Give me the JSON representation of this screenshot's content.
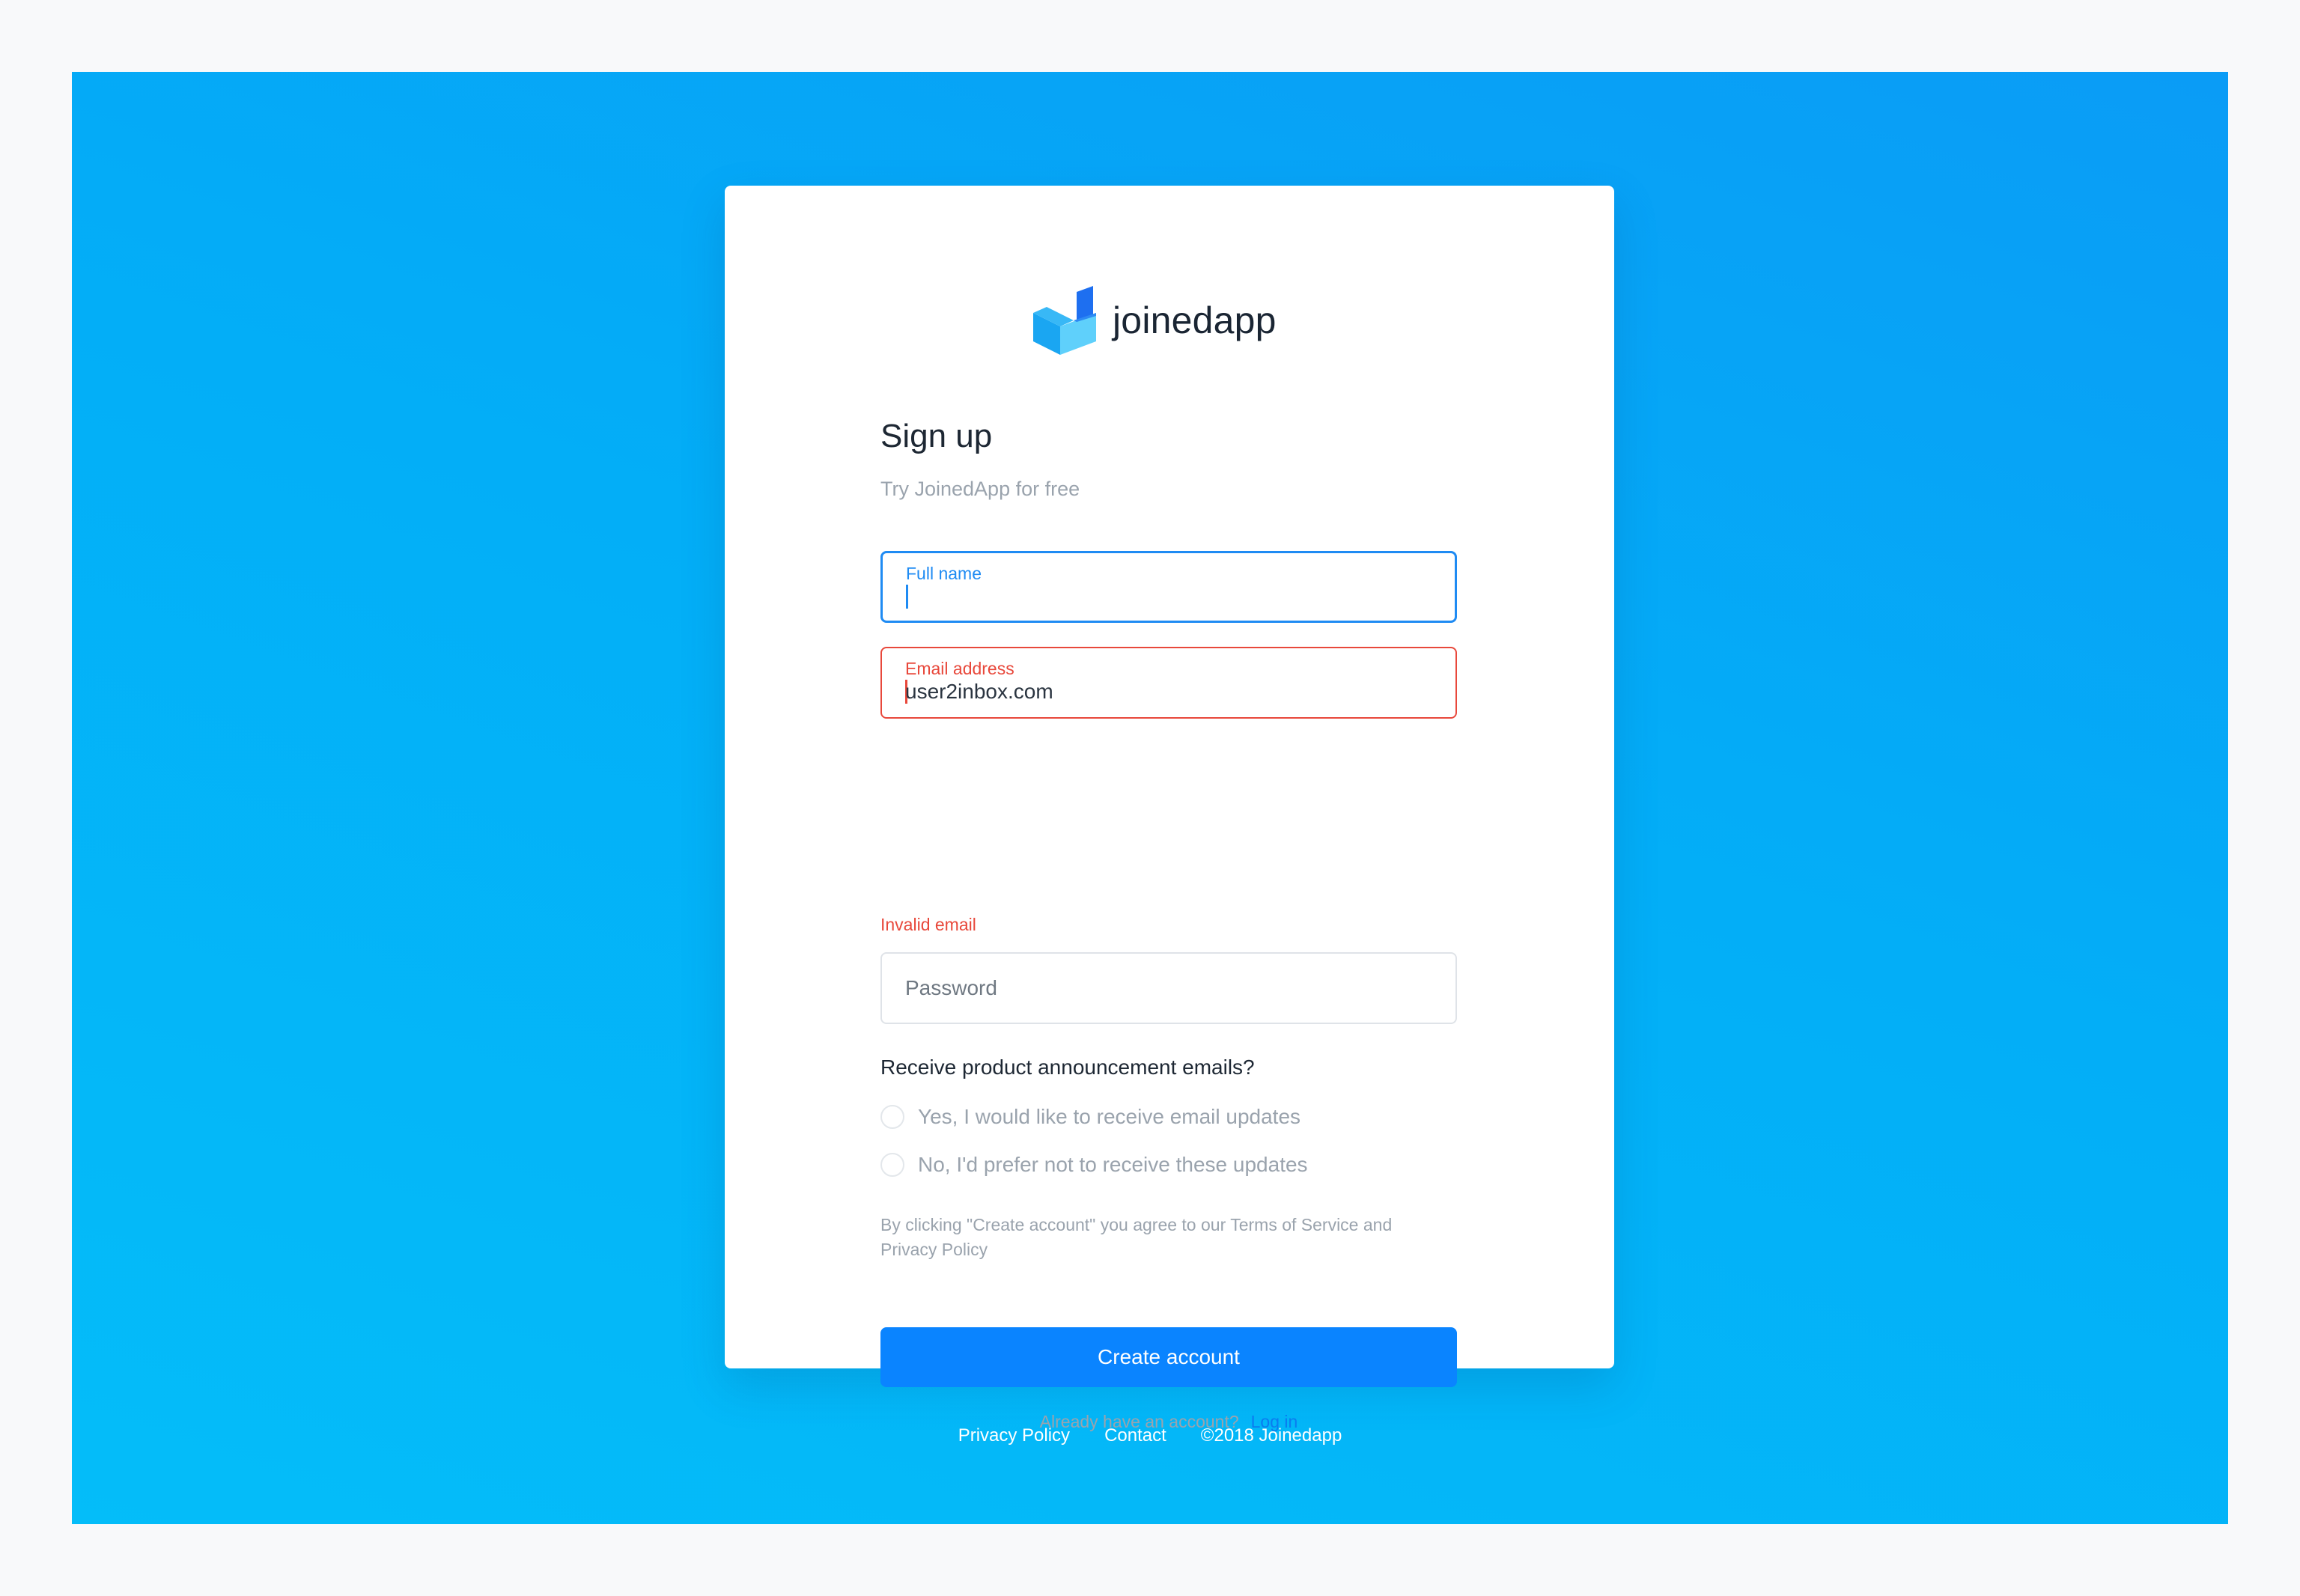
{
  "brand": {
    "name": "joinedapp",
    "logo_icon": "joinedapp-box-logo",
    "colors": {
      "primary": "#0a84ff",
      "error": "#e8483b",
      "background": "#03aef7"
    }
  },
  "signup": {
    "title": "Sign up",
    "subtitle": "Try JoinedApp for free",
    "full_name": {
      "label": "Full name",
      "value": ""
    },
    "email": {
      "label": "Email address",
      "value": "user2inbox.com",
      "error": "Invalid email"
    },
    "password": {
      "placeholder": "Password"
    },
    "emails_question": "Receive product announcement emails?",
    "options": [
      {
        "label": "Yes, I would like to receive email updates"
      },
      {
        "label": "No, I'd prefer not to receive these updates"
      }
    ],
    "legal_line1": "By clicking \"Create account\" you agree to our Terms of Service  and",
    "legal_line2": "Privacy Policy",
    "submit_label": "Create account",
    "already_text": "Already have an account?",
    "login_label": "Log in"
  },
  "footer": {
    "privacy": "Privacy Policy",
    "contact": "Contact",
    "copyright": "©2018 Joinedapp"
  }
}
